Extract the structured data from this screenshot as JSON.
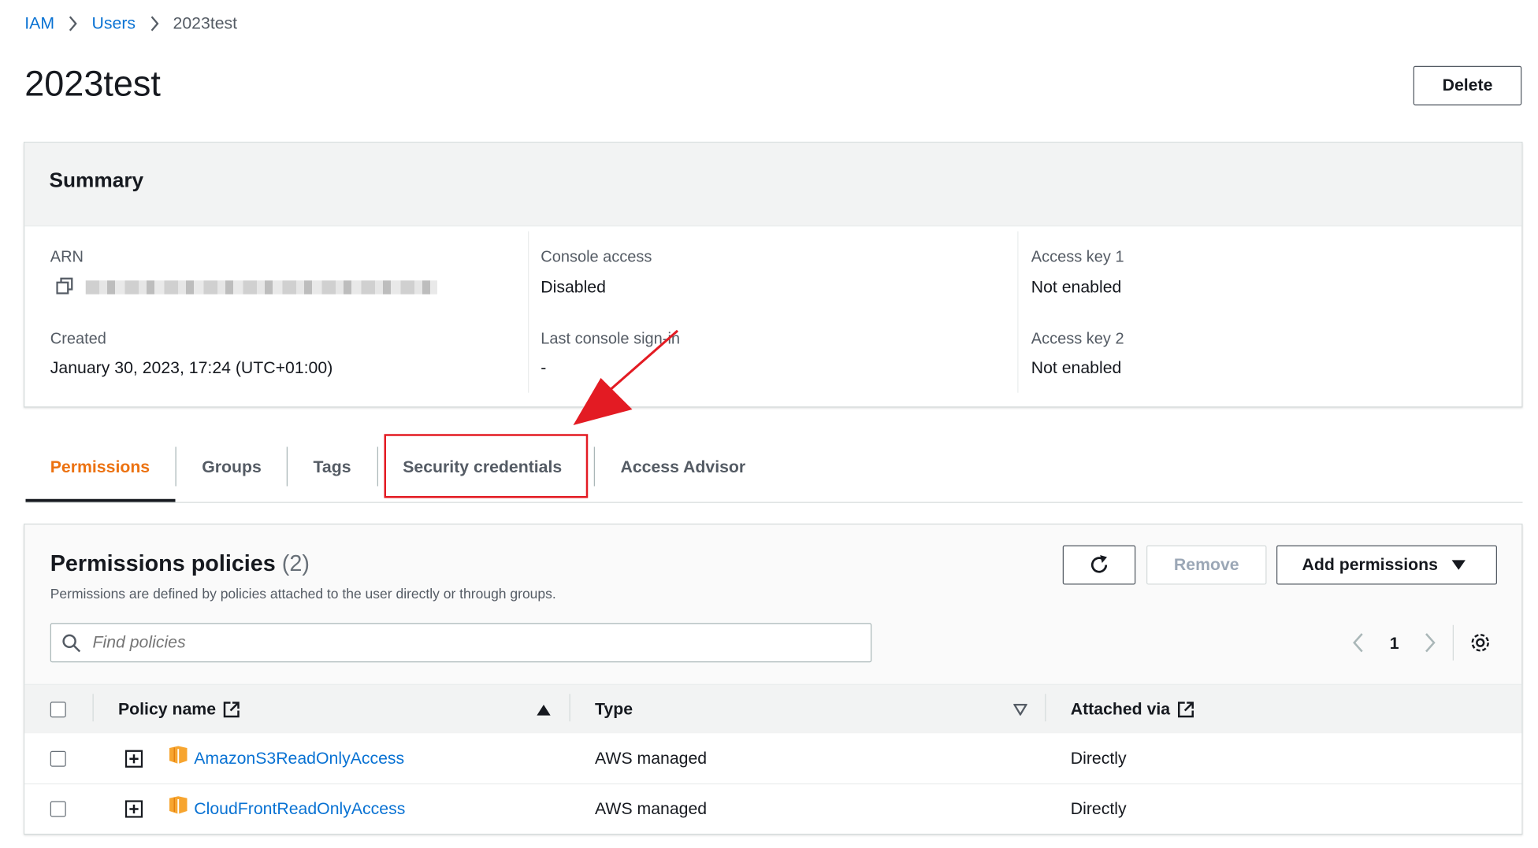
{
  "breadcrumb": [
    "IAM",
    "Users",
    "2023test"
  ],
  "page_title": "2023test",
  "delete_label": "Delete",
  "summary": {
    "title": "Summary",
    "arn_label": "ARN",
    "created_label": "Created",
    "created_value": "January 30, 2023, 17:24 (UTC+01:00)",
    "console_access_label": "Console access",
    "console_access_value": "Disabled",
    "last_signin_label": "Last console sign-in",
    "last_signin_value": "-",
    "access_key1_label": "Access key 1",
    "access_key1_value": "Not enabled",
    "access_key2_label": "Access key 2",
    "access_key2_value": "Not enabled"
  },
  "tabs": [
    "Permissions",
    "Groups",
    "Tags",
    "Security credentials",
    "Access Advisor"
  ],
  "permissions": {
    "title": "Permissions policies",
    "count": "(2)",
    "description": "Permissions are defined by policies attached to the user directly or through groups.",
    "remove_label": "Remove",
    "add_label": "Add permissions",
    "search_placeholder": "Find policies",
    "page": "1",
    "columns": [
      "Policy name",
      "Type",
      "Attached via"
    ],
    "rows": [
      {
        "name": "AmazonS3ReadOnlyAccess",
        "type": "AWS managed",
        "via": "Directly"
      },
      {
        "name": "CloudFrontReadOnlyAccess",
        "type": "AWS managed",
        "via": "Directly"
      }
    ]
  },
  "colors": {
    "accent": "#ec7211",
    "link": "#0972d3",
    "highlight": "#e31b23"
  },
  "icons": [
    "chevron-right-icon",
    "copy-icon",
    "refresh-icon",
    "caret-down-icon",
    "search-icon",
    "chevron-left-icon",
    "gear-icon",
    "external-link-icon",
    "sort-up-icon",
    "sort-down-icon",
    "expand-icon",
    "policy-cube-icon"
  ]
}
